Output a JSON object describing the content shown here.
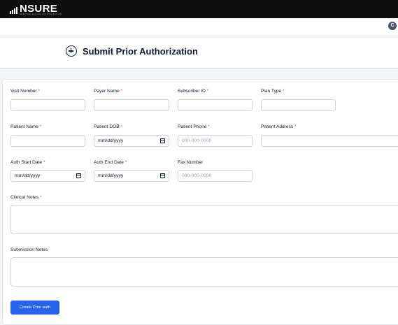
{
  "app": {
    "logo_text": "NSURE",
    "logo_tagline": "BREATHE EASIER AUTHORIZATION",
    "avatar_initial": "C"
  },
  "page": {
    "title": "Submit Prior Authorization"
  },
  "form": {
    "visit_number": {
      "label": "Visit Number",
      "required": "*",
      "value": ""
    },
    "payer_name": {
      "label": "Payer Name",
      "required": "*",
      "value": ""
    },
    "subscriber_id": {
      "label": "Subscriber ID",
      "required": "*",
      "value": ""
    },
    "plan_type": {
      "label": "Plan Type",
      "required": "*",
      "value": ""
    },
    "patient_name": {
      "label": "Patient Name",
      "required": "*",
      "value": ""
    },
    "patient_dob": {
      "label": "Patient DOB",
      "required": "*",
      "value": "mm/dd/yyyy"
    },
    "patient_phone": {
      "label": "Patient Phone",
      "required": "*",
      "placeholder": "000-000-0000"
    },
    "patient_address": {
      "label": "Patient Address",
      "required": "*",
      "value": ""
    },
    "auth_start_date": {
      "label": "Auth Start Date",
      "required": "*",
      "value": "mm/dd/yyyy"
    },
    "auth_end_date": {
      "label": "Auth End Date",
      "required": "*",
      "value": "mm/dd/yyyy"
    },
    "fax_number": {
      "label": "Fax Number",
      "placeholder": "000-000-0000"
    },
    "clinical_notes": {
      "label": "Clinical Notes",
      "required": "*"
    },
    "submission_notes": {
      "label": "Submission Notes"
    },
    "submit_label": "Create Prior auth"
  },
  "colors": {
    "topbar": "#0f0f10",
    "primary": "#2563eb",
    "required": "#ef4444"
  },
  "icons": {
    "title": "plus-circle-icon",
    "date": "calendar-icon"
  }
}
